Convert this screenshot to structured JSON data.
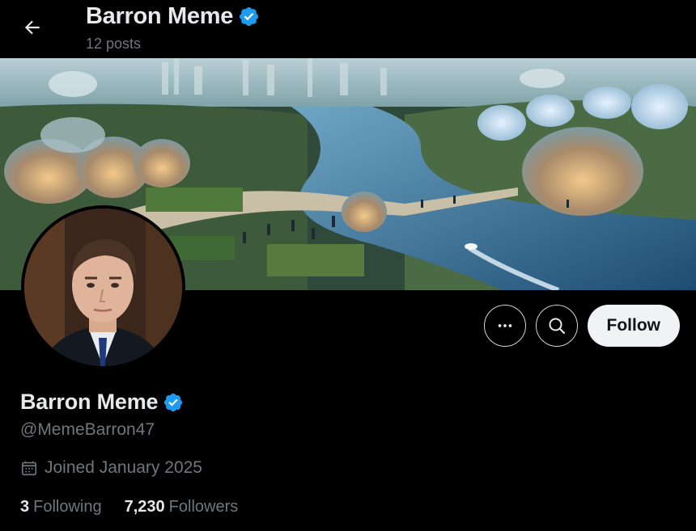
{
  "header": {
    "back_icon": "arrow-left-icon",
    "title": "Barron Meme",
    "verified_icon": "verified-badge-icon",
    "post_count": "12 posts"
  },
  "banner": {
    "description_icon": "banner-image"
  },
  "actions": {
    "more_icon": "more-horizontal-icon",
    "search_icon": "search-icon",
    "follow_label": "Follow"
  },
  "profile": {
    "name": "Barron Meme",
    "handle": "@MemeBarron47",
    "joined": "Joined January 2025",
    "calendar_icon": "calendar-icon",
    "following_count": "3",
    "following_label": "Following",
    "followers_count": "7,230",
    "followers_label": "Followers"
  },
  "colors": {
    "background": "#000000",
    "text_primary": "#e7e9ea",
    "text_secondary": "#71767b",
    "verified": "#1d9bf0",
    "follow_bg": "#eff3f4"
  }
}
